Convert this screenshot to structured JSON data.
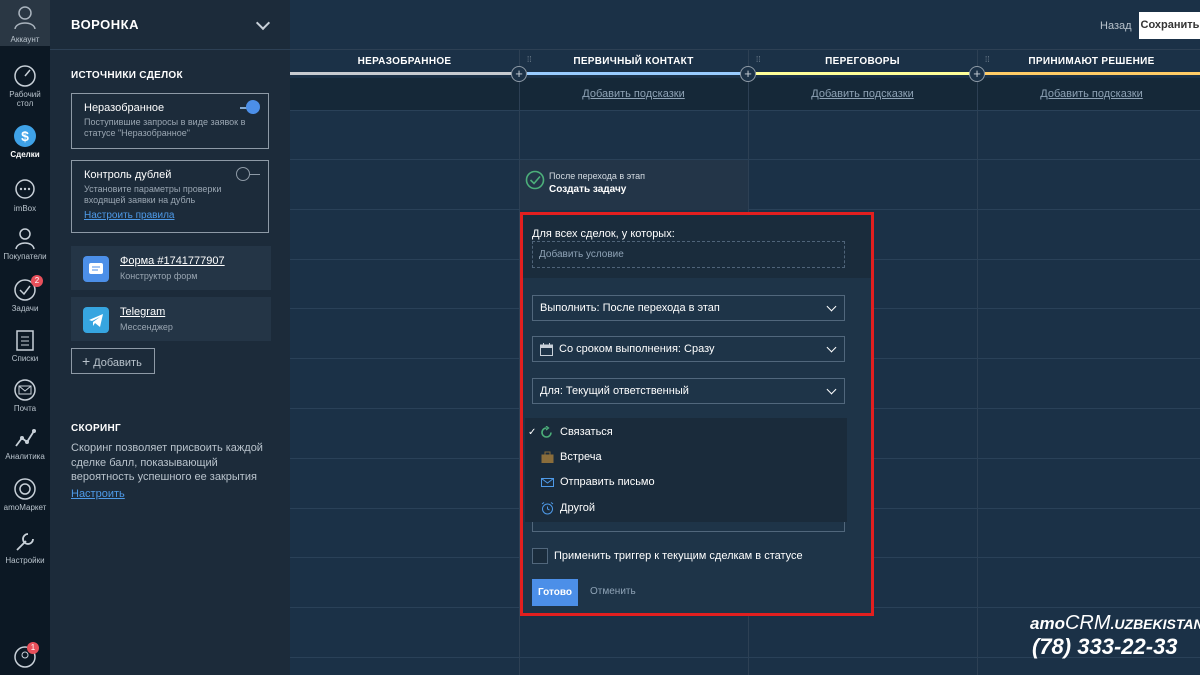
{
  "nav": {
    "account": "Аккаунт",
    "items": [
      {
        "label": "Рабочий стол"
      },
      {
        "label": "Сделки"
      },
      {
        "label": "imBox"
      },
      {
        "label": "Покупатели"
      },
      {
        "label": "Задачи",
        "badge": "2"
      },
      {
        "label": "Списки"
      },
      {
        "label": "Почта"
      },
      {
        "label": "Аналитика"
      },
      {
        "label": "amoМаркет"
      },
      {
        "label": "Настройки"
      }
    ],
    "bottom_badge": "1"
  },
  "panel": {
    "title": "ВОРОНКА",
    "sources_title": "ИСТОЧНИКИ СДЕЛОК",
    "card_unsorted": {
      "title": "Неразобранное",
      "desc": "Поступившие запросы в виде заявок в статусе \"Неразобранное\""
    },
    "card_dupes": {
      "title": "Контроль дублей",
      "desc": "Установите параметры проверки входящей заявки на дубль",
      "link": "Настроить правила"
    },
    "sources": [
      {
        "name": "Форма #1741777907",
        "sub": "Конструктор форм"
      },
      {
        "name": "Telegram",
        "sub": "Мессенджер"
      }
    ],
    "add_label": "Добавить",
    "scoring_title": "СКОРИНГ",
    "scoring_text": "Скоринг позволяет присвоить каждой сделке балл, показывающий вероятность успешного ее закрытия",
    "scoring_link": "Настроить"
  },
  "topbar": {
    "back": "Назад",
    "save": "Сохранить"
  },
  "columns": [
    {
      "title": "НЕРАЗОБРАННОЕ",
      "color": "#c7cbd0",
      "hint": ""
    },
    {
      "title": "ПЕРВИЧНЫЙ КОНТАКТ",
      "color": "#99ccff",
      "hint": "Добавить подсказки"
    },
    {
      "title": "ПЕРЕГОВОРЫ",
      "color": "#ffff99",
      "hint": "Добавить подсказки"
    },
    {
      "title": "ПРИНИМАЮТ РЕШЕНИЕ",
      "color": "#ffcc66",
      "hint": "Добавить подсказки"
    }
  ],
  "trigger": {
    "line1": "После перехода в этап",
    "line2": "Создать задачу"
  },
  "modal": {
    "title": "Для всех сделок, у которых:",
    "condition_placeholder": "Добавить условие",
    "execute": "Выполнить: После перехода в этап",
    "due": "Со сроком выполнения: Сразу",
    "for": "Для: Текущий ответственный",
    "task_types": [
      {
        "label": "Связаться",
        "selected": true,
        "icon": "phone-refresh-icon"
      },
      {
        "label": "Встреча",
        "selected": false,
        "icon": "briefcase-icon"
      },
      {
        "label": "Отправить письмо",
        "selected": false,
        "icon": "envelope-icon"
      },
      {
        "label": "Другой",
        "selected": false,
        "icon": "alarm-clock-icon"
      }
    ],
    "apply_label": "Применить триггер к текущим сделкам в статусе",
    "done": "Готово",
    "cancel": "Отменить"
  },
  "watermark": {
    "brand_a": "amo",
    "brand_b": "CRM",
    "brand_c": ".UZBEKISTAN",
    "phone": "(78) 333-22-33"
  }
}
